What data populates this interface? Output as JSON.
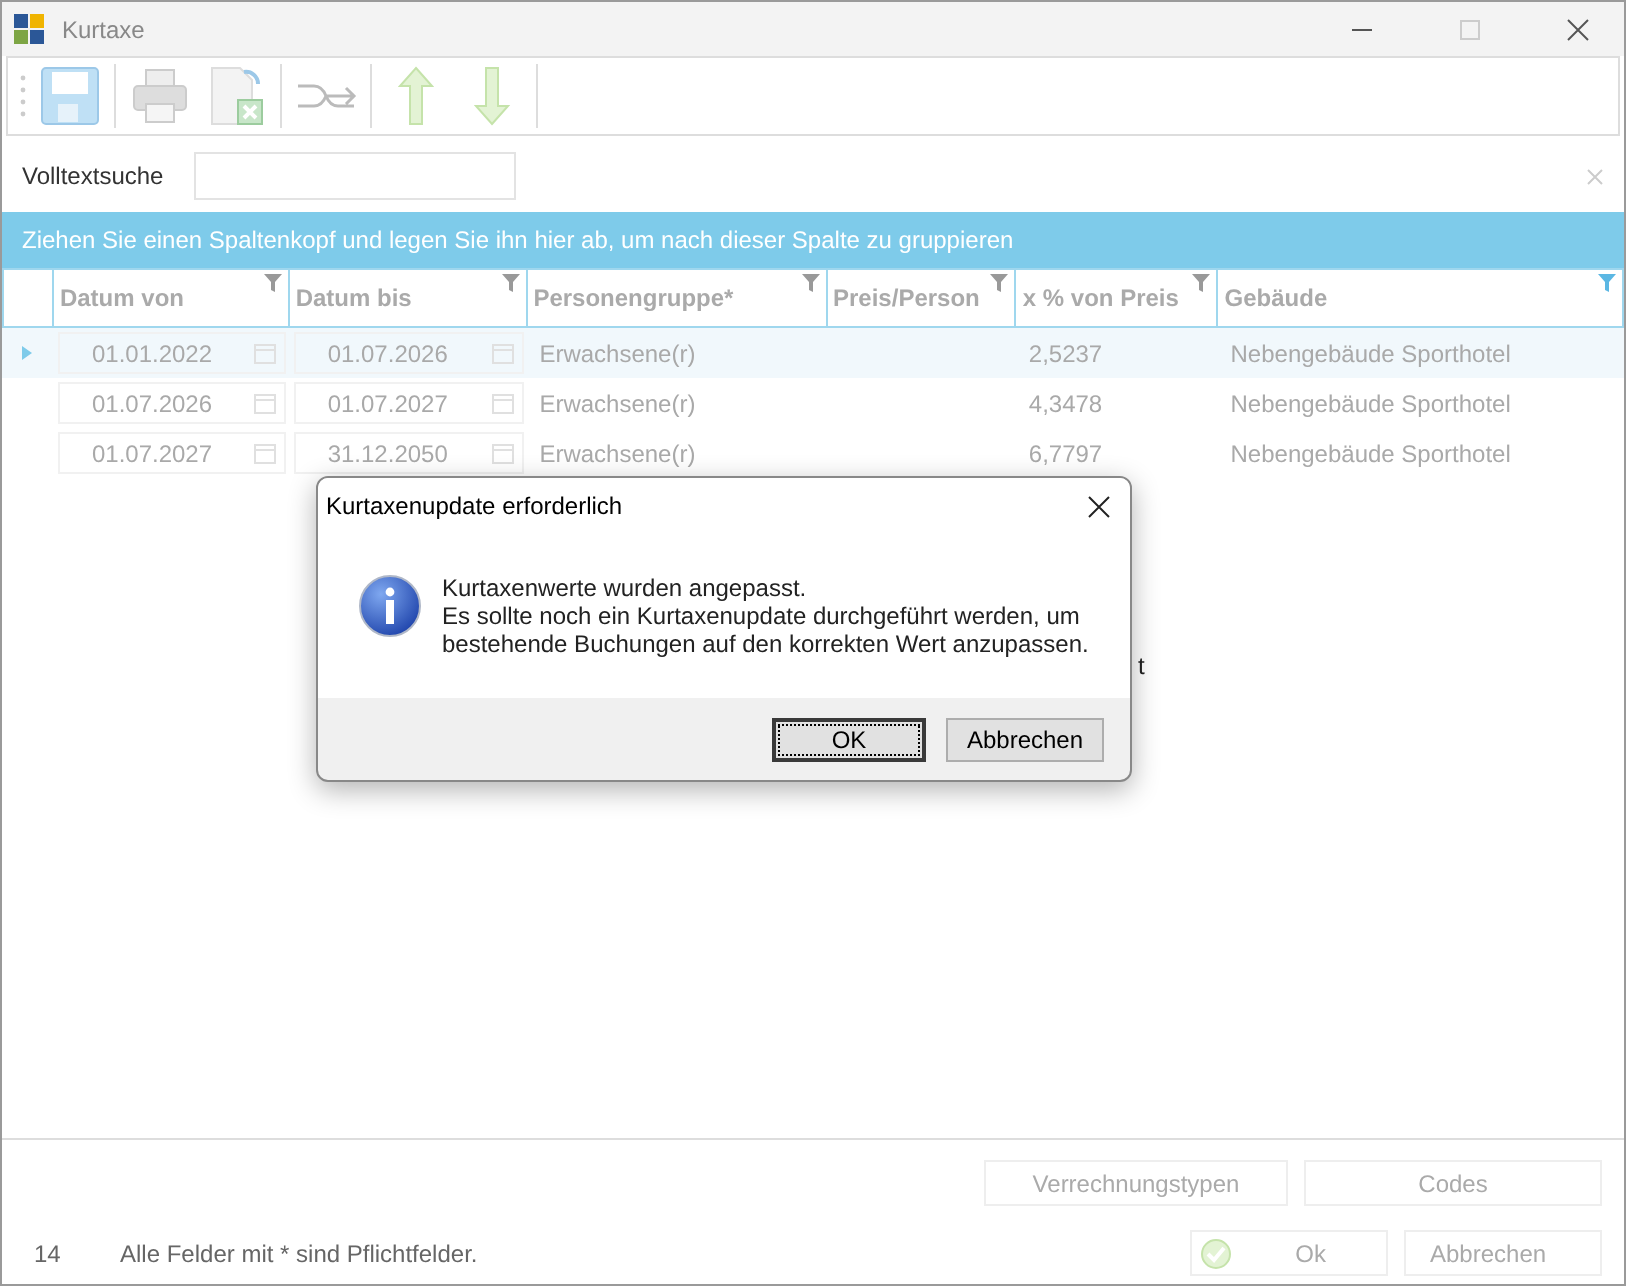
{
  "window": {
    "title": "Kurtaxe"
  },
  "search": {
    "label": "Volltextsuche"
  },
  "group_panel": "Ziehen Sie einen Spaltenkopf und legen Sie ihn hier ab, um nach dieser Spalte zu gruppieren",
  "table": {
    "columns": [
      {
        "label": "Datum von",
        "kind": "date",
        "filtered": false
      },
      {
        "label": "Datum bis",
        "kind": "date",
        "filtered": false
      },
      {
        "label": "Personengruppe*",
        "kind": "text",
        "filtered": false
      },
      {
        "label": "Preis/Person",
        "kind": "text",
        "filtered": false
      },
      {
        "label": "x % von Preis",
        "kind": "text",
        "filtered": false
      },
      {
        "label": "Gebäude",
        "kind": "text",
        "filtered": true
      }
    ],
    "rows": [
      {
        "selected": true,
        "cells": [
          "01.01.2022",
          "01.07.2026",
          "Erwachsene(r)",
          "",
          "2,5237",
          "Nebengebäude Sporthotel"
        ]
      },
      {
        "selected": false,
        "cells": [
          "01.07.2026",
          "01.07.2027",
          "Erwachsene(r)",
          "",
          "4,3478",
          "Nebengebäude Sporthotel"
        ]
      },
      {
        "selected": false,
        "cells": [
          "01.07.2027",
          "31.12.2050",
          "Erwachsene(r)",
          "",
          "6,7797",
          "Nebengebäude Sporthotel"
        ]
      }
    ],
    "hidden_fragment": "t"
  },
  "footer": {
    "buttons": [
      "Verrechnungstypen",
      "Codes"
    ],
    "count": "14",
    "note": "Alle Felder mit * sind Pflichtfelder.",
    "ok": "Ok",
    "cancel": "Abbrechen"
  },
  "dialog": {
    "title": "Kurtaxenupdate erforderlich",
    "lines": [
      "Kurtaxenwerte wurden angepasst.",
      "Es sollte noch ein Kurtaxenupdate durchgeführt werden, um",
      "bestehende Buchungen auf den korrekten Wert anzupassen."
    ],
    "buttons": [
      {
        "label": "OK",
        "selected": true
      },
      {
        "label": "Abbrechen",
        "selected": false
      }
    ]
  }
}
